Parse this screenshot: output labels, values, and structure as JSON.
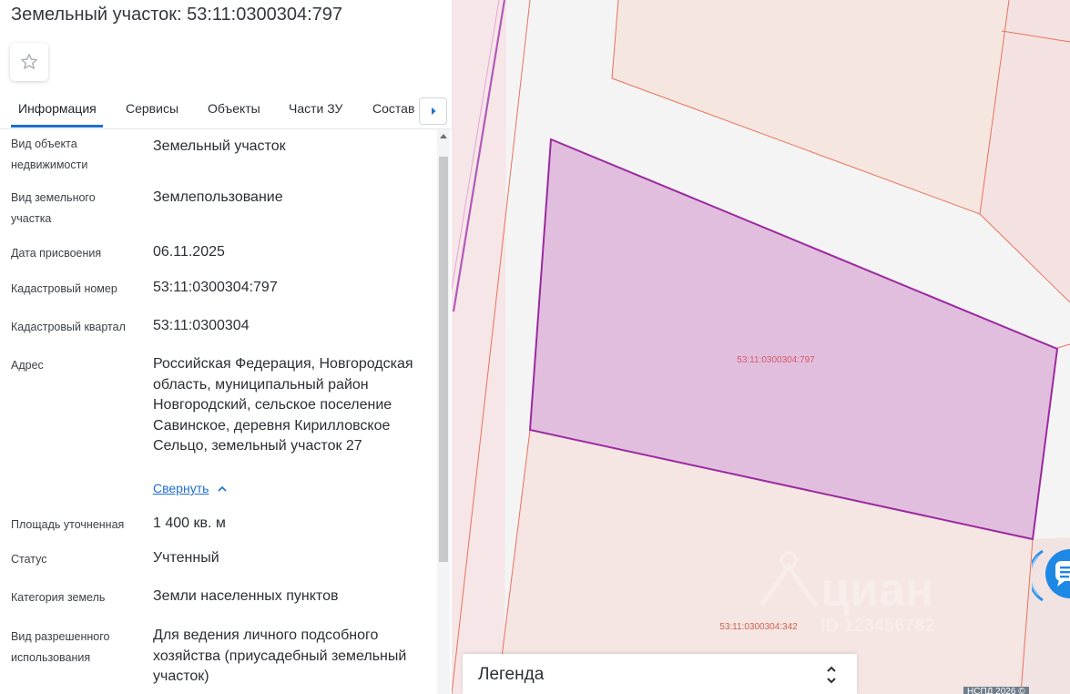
{
  "header": {
    "title": "Земельный участок: 53:11:0300304:797"
  },
  "tabs": [
    {
      "label": "Информация"
    },
    {
      "label": "Сервисы"
    },
    {
      "label": "Объекты"
    },
    {
      "label": "Части ЗУ"
    },
    {
      "label": "Состав"
    }
  ],
  "info": [
    {
      "label": "Вид объекта недвижимости",
      "value": "Земельный участок"
    },
    {
      "label": "Вид земельного участка",
      "value": "Землепользование"
    },
    {
      "label": "Дата присвоения",
      "value": "06.11.2025"
    },
    {
      "label": "Кадастровый номер",
      "value": "53:11:0300304:797"
    },
    {
      "label": "Кадастровый квартал",
      "value": "53:11:0300304"
    },
    {
      "label": "Адрес",
      "value": "Российская Федерация, Новгородская область, муниципальный район Новгородский, сельское поселение Савинское, деревня Кирилловское Сельцо, земельный участок 27"
    },
    {
      "label": "Площадь уточненная",
      "value": "1 400 кв. м"
    },
    {
      "label": "Статус",
      "value": "Учтенный"
    },
    {
      "label": "Категория земель",
      "value": "Земли населенных пунктов"
    },
    {
      "label": "Вид разрешенного использования",
      "value": "Для ведения личного подсобного хозяйства (приусадебный земельный участок)"
    }
  ],
  "collapse_label": "Свернуть",
  "map": {
    "parcel_label": "53:11:0300304:797",
    "neighbor_label": "53:11:0300304:342",
    "watermark": "циан",
    "watermark_sub": "ID 123456782",
    "copyright": "НСПД 2026 ©",
    "parcel_color": "#9b2aa0",
    "boundary_color": "#e8725a"
  },
  "legend": {
    "label": "Легенда"
  },
  "icons": {
    "favorite": "star-icon",
    "tabs_next": "chevron-right-icon",
    "collapse": "chevron-up-icon",
    "legend_toggle": "chevron-up-down-icon",
    "chat": "chat-icon"
  }
}
